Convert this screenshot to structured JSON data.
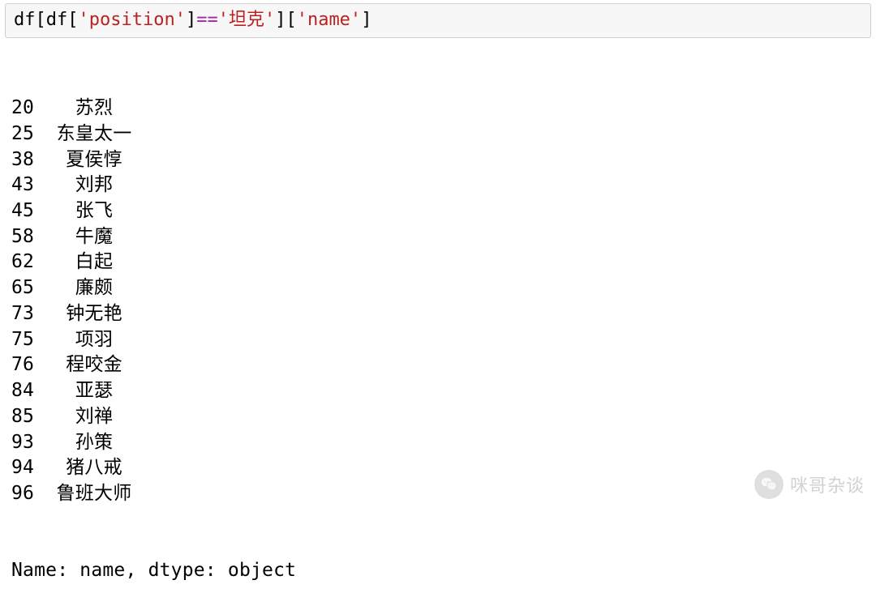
{
  "code": {
    "var1": "df",
    "lbr1": "[",
    "var2": "df",
    "lbr2": "[",
    "str1": "'position'",
    "rbr1": "]",
    "op": "==",
    "str2": "'坦克'",
    "rbr2": "]",
    "lbr3": "[",
    "str3": "'name'",
    "rbr3": "]"
  },
  "output": {
    "rows": [
      {
        "index": "20",
        "value": "苏烈"
      },
      {
        "index": "25",
        "value": "东皇太一"
      },
      {
        "index": "38",
        "value": "夏侯惇"
      },
      {
        "index": "43",
        "value": "刘邦"
      },
      {
        "index": "45",
        "value": "张飞"
      },
      {
        "index": "58",
        "value": "牛魔"
      },
      {
        "index": "62",
        "value": "白起"
      },
      {
        "index": "65",
        "value": "廉颇"
      },
      {
        "index": "73",
        "value": "钟无艳"
      },
      {
        "index": "75",
        "value": "项羽"
      },
      {
        "index": "76",
        "value": "程咬金"
      },
      {
        "index": "84",
        "value": "亚瑟"
      },
      {
        "index": "85",
        "value": "刘禅"
      },
      {
        "index": "93",
        "value": "孙策"
      },
      {
        "index": "94",
        "value": "猪八戒"
      },
      {
        "index": "96",
        "value": "鲁班大师"
      }
    ],
    "footer": "Name: name, dtype: object"
  },
  "watermark": {
    "text": "咪哥杂谈"
  }
}
